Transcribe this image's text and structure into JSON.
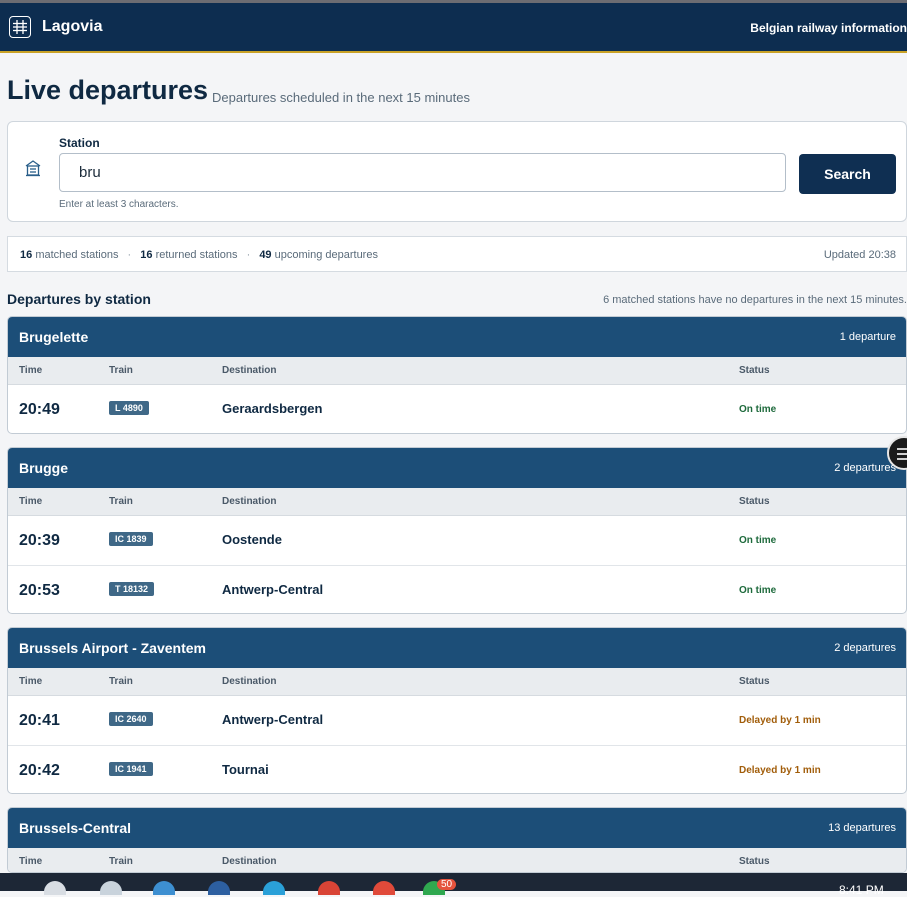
{
  "app": {
    "name": "Lagovia",
    "tagline": "Belgian railway information"
  },
  "page": {
    "title": "Live departures",
    "subtitle": "Departures scheduled in the next 15 minutes"
  },
  "search": {
    "label": "Station",
    "value": "bru",
    "hint": "Enter at least 3 characters.",
    "button": "Search"
  },
  "stats": {
    "matched_value": "16",
    "matched_label": "matched stations",
    "returned_value": "16",
    "returned_label": "returned stations",
    "upcoming_value": "49",
    "upcoming_label": "upcoming departures",
    "separator": "·",
    "updated": "Updated 20:38"
  },
  "departures": {
    "heading": "Departures by station",
    "note": "6 matched stations have no departures in the next 15 minutes.",
    "columns": {
      "time": "Time",
      "train": "Train",
      "destination": "Destination",
      "status": "Status"
    },
    "stations": [
      {
        "name": "Brugelette",
        "count": "1 departure",
        "rows": [
          {
            "time": "20:49",
            "train": "L 4890",
            "destination": "Geraardsbergen",
            "status": "On time",
            "status_kind": "ok"
          }
        ]
      },
      {
        "name": "Brugge",
        "count": "2 departures",
        "rows": [
          {
            "time": "20:39",
            "train": "IC 1839",
            "destination": "Oostende",
            "status": "On time",
            "status_kind": "ok"
          },
          {
            "time": "20:53",
            "train": "T 18132",
            "destination": "Antwerp-Central",
            "status": "On time",
            "status_kind": "ok"
          }
        ]
      },
      {
        "name": "Brussels Airport - Zaventem",
        "count": "2 departures",
        "rows": [
          {
            "time": "20:41",
            "train": "IC 2640",
            "destination": "Antwerp-Central",
            "status": "Delayed by 1 min",
            "status_kind": "delay"
          },
          {
            "time": "20:42",
            "train": "IC 1941",
            "destination": "Tournai",
            "status": "Delayed by 1 min",
            "status_kind": "delay"
          }
        ]
      },
      {
        "name": "Brussels-Central",
        "count": "13 departures",
        "rows": []
      }
    ]
  },
  "taskbar": {
    "clock": "8:41 PM",
    "badge": "50"
  },
  "colors": {
    "header": "#0d2d50",
    "card_header": "#1c4e78",
    "on_time": "#1e6a3c",
    "delayed": "#a15d0a",
    "accent": "#c9a227"
  }
}
